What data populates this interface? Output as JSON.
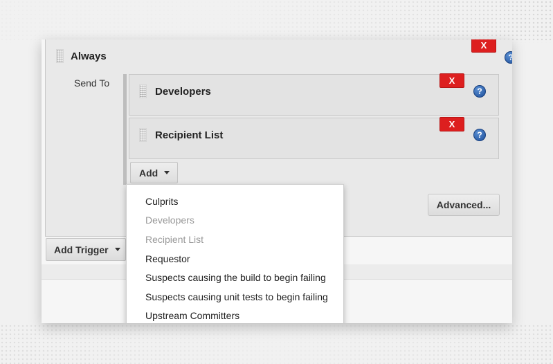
{
  "trigger": {
    "title": "Always",
    "delete_label": "X",
    "help_label": "?",
    "send_to_label": "Send To"
  },
  "recipients": [
    {
      "title": "Developers",
      "delete_label": "X",
      "help_label": "?"
    },
    {
      "title": "Recipient List",
      "delete_label": "X",
      "help_label": "?"
    }
  ],
  "add_button": {
    "label": "Add"
  },
  "advanced_button": {
    "label": "Advanced..."
  },
  "add_trigger_button": {
    "label": "Add Trigger"
  },
  "menu": {
    "items": [
      {
        "label": "Culprits",
        "enabled": true
      },
      {
        "label": "Developers",
        "enabled": false
      },
      {
        "label": "Recipient List",
        "enabled": false
      },
      {
        "label": "Requestor",
        "enabled": true
      },
      {
        "label": "Suspects causing the build to begin failing",
        "enabled": true
      },
      {
        "label": "Suspects causing unit tests to begin failing",
        "enabled": true
      },
      {
        "label": "Upstream Committers",
        "enabled": true
      }
    ]
  },
  "colors": {
    "delete_red": "#dd1f1f",
    "help_blue": "#1d4f9b"
  },
  "icons": [
    "drag-handle-icon",
    "help-icon",
    "caret-down-icon"
  ]
}
